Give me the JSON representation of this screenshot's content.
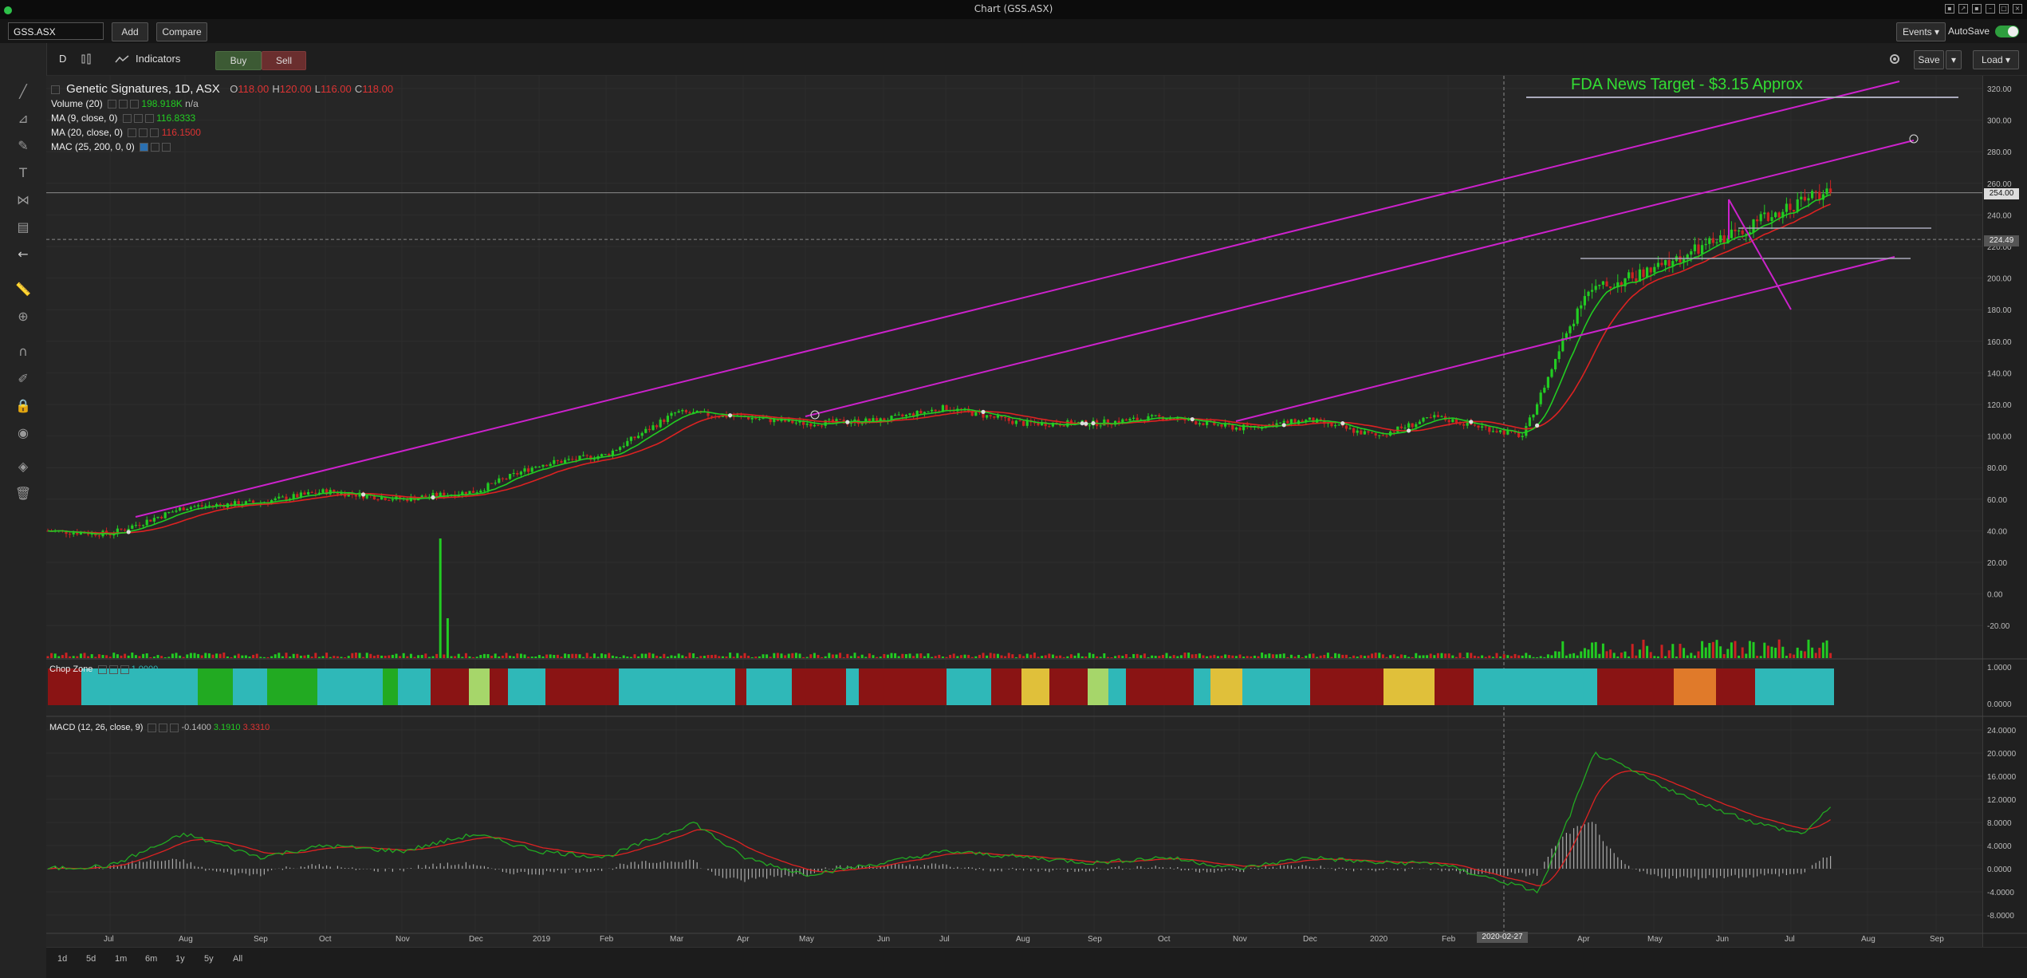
{
  "window": {
    "title": "Chart (GSS.ASX)"
  },
  "toolbar": {
    "symbol": "GSS.ASX",
    "add_label": "Add",
    "compare_label": "Compare",
    "events_label": "Events ▾",
    "autosave_label": "AutoSave",
    "interval": "D",
    "indicators_label": "Indicators",
    "buy_label": "Buy",
    "sell_label": "Sell",
    "save_label": "Save",
    "load_label": "Load ▾"
  },
  "legend": {
    "title": "Genetic Signatures, 1D, ASX",
    "o_label": "O",
    "o_val": "118.00",
    "h_label": "H",
    "h_val": "120.00",
    "l_label": "L",
    "l_val": "116.00",
    "c_label": "C",
    "c_val": "118.00",
    "volume": {
      "name": "Volume (20)",
      "val": "198.918K",
      "extra": "n/a"
    },
    "ma9": {
      "name": "MA (9, close, 0)",
      "val": "116.8333"
    },
    "ma20": {
      "name": "MA (20, close, 0)",
      "val": "116.1500"
    },
    "mac": {
      "name": "MAC (25, 200, 0, 0)"
    }
  },
  "chop": {
    "name": "Chop Zone",
    "val": "1.0000"
  },
  "macd": {
    "name": "MACD (12, 26, close, 9)",
    "v1": "-0.1400",
    "v2": "3.1910",
    "v3": "3.3310"
  },
  "annotation": "FDA News Target - $3.15 Approx",
  "crosshair_date": "2020-02-27",
  "price_markers": {
    "last": "254.00",
    "cross": "224.49"
  },
  "ranges": [
    "1d",
    "5d",
    "1m",
    "6m",
    "1y",
    "5y",
    "All"
  ],
  "colors": {
    "up": "#22cc22",
    "down": "#cc2222",
    "ma9": "#22cc22",
    "ma20": "#dd2222",
    "channel": "#cc22cc",
    "annotation": "#33dd33",
    "chop_teal": "#2fb8b8",
    "chop_red": "#8a1414"
  },
  "chart_data": [
    {
      "type": "line",
      "title": "Genetic Signatures, 1D, ASX",
      "ylim": [
        -30,
        330
      ],
      "y_ticks": [
        "320.00",
        "300.00",
        "280.00",
        "260.00",
        "240.00",
        "220.00",
        "200.00",
        "180.00",
        "160.00",
        "140.00",
        "120.00",
        "100.00",
        "80.00",
        "60.00",
        "40.00",
        "20.00",
        "0.00",
        "-20.00"
      ],
      "x_ticks": [
        "Jul",
        "Aug",
        "Sep",
        "Oct",
        "Nov",
        "Dec",
        "2019",
        "Feb",
        "Mar",
        "Apr",
        "May",
        "Jun",
        "Jul",
        "Aug",
        "Sep",
        "Oct",
        "Nov",
        "Dec",
        "2020",
        "Feb",
        "Apr",
        "May",
        "Jun",
        "Jul",
        "Aug",
        "Sep"
      ],
      "series": [
        {
          "name": "",
          "x": [
            "2018-06",
            "2018-07",
            "2018-08",
            "2018-09",
            "2018-10",
            "2018-11",
            "2018-12",
            "2019-01",
            "2019-02",
            "2019-03",
            "2019-04",
            "2019-05",
            "2019-06",
            "2019-07",
            "2019-08",
            "2019-09",
            "2019-10",
            "2019-11",
            "2019-12",
            "2020-01",
            "2020-02",
            "2020-03",
            "2020-04",
            "2020-05",
            "2020-06",
            "2020-07"
          ],
          "values": [
            40,
            38,
            55,
            58,
            65,
            60,
            65,
            82,
            88,
            115,
            112,
            108,
            110,
            118,
            108,
            108,
            112,
            105,
            110,
            100,
            112,
            100,
            190,
            205,
            225,
            254
          ]
        }
      ]
    },
    {
      "type": "heatmap",
      "title": "Chop Zone",
      "ylim": [
        0,
        1
      ],
      "y_ticks": [
        "1.0000",
        "0.0000"
      ]
    },
    {
      "type": "line",
      "title": "MACD (12, 26, close, 9)",
      "ylim": [
        -8,
        24
      ],
      "y_ticks": [
        "24.0000",
        "20.0000",
        "16.0000",
        "12.0000",
        "8.0000",
        "4.0000",
        "0.0000",
        "-4.0000",
        "-8.0000"
      ],
      "series": [
        {
          "name": "",
          "values": [
            0,
            0.5,
            6,
            2,
            4,
            3,
            6,
            3,
            2,
            8,
            2,
            -1,
            1,
            3,
            2,
            1,
            2,
            0,
            2,
            1,
            1,
            -4,
            20,
            12,
            8,
            6,
            11
          ]
        }
      ]
    }
  ]
}
